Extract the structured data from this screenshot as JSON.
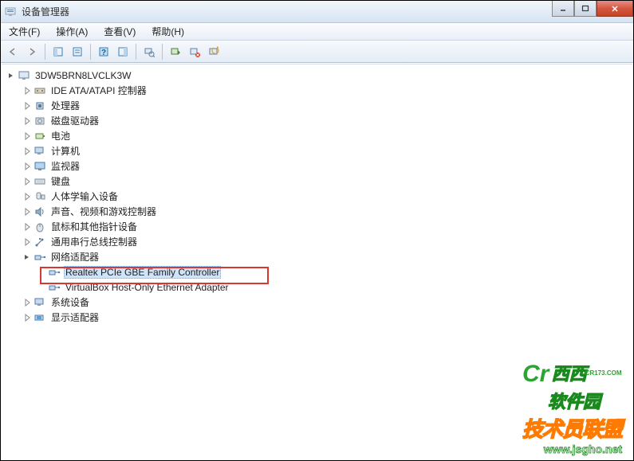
{
  "window": {
    "title": "设备管理器"
  },
  "menu": {
    "file": "文件(F)",
    "action": "操作(A)",
    "view": "查看(V)",
    "help": "帮助(H)"
  },
  "tree": {
    "root": "3DW5BRN8LVCLK3W",
    "nodes": [
      {
        "label": "IDE ATA/ATAPI 控制器",
        "icon": "ide"
      },
      {
        "label": "处理器",
        "icon": "cpu"
      },
      {
        "label": "磁盘驱动器",
        "icon": "disk"
      },
      {
        "label": "电池",
        "icon": "battery"
      },
      {
        "label": "计算机",
        "icon": "computer"
      },
      {
        "label": "监视器",
        "icon": "monitor"
      },
      {
        "label": "键盘",
        "icon": "keyboard"
      },
      {
        "label": "人体学输入设备",
        "icon": "hid"
      },
      {
        "label": "声音、视频和游戏控制器",
        "icon": "sound"
      },
      {
        "label": "鼠标和其他指针设备",
        "icon": "mouse"
      },
      {
        "label": "通用串行总线控制器",
        "icon": "usb"
      },
      {
        "label": "网络适配器",
        "icon": "network",
        "expanded": true,
        "children": [
          {
            "label": "Realtek PCIe GBE Family Controller",
            "icon": "netcard",
            "selected": true
          },
          {
            "label": "VirtualBox Host-Only Ethernet Adapter",
            "icon": "netcard"
          }
        ]
      },
      {
        "label": "系统设备",
        "icon": "system"
      },
      {
        "label": "显示适配器",
        "icon": "display"
      }
    ]
  },
  "watermark": {
    "brand1": "西西",
    "brand2": "软件园",
    "tiny": "CR173.COM",
    "line2": "技术员联盟",
    "url": "www.jsgho.net"
  }
}
